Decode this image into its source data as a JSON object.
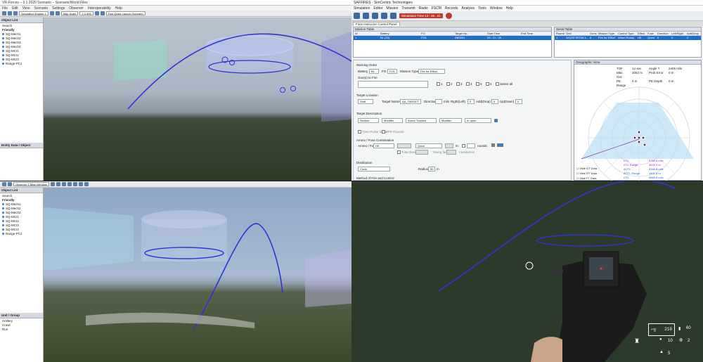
{
  "q1": {
    "title": "VR-Forces – 3.1 2020 Scenario – Scenario/World Files",
    "menu": [
      "File",
      "Edit",
      "View",
      "Scenario",
      "Settings",
      "Observer",
      "Interoperability",
      "Help"
    ],
    "toolbar_fields": [
      "Simulation Engine 1",
      "Map Scale",
      "1:2,500",
      "Run Quick Launch Scenario"
    ],
    "side_head": "Object List",
    "search_label": "Search",
    "tree_root": "Friendly",
    "tree_items": [
      "SQ-Mech1",
      "SQ-Mech2",
      "SQ-Mech3",
      "SQ-Mech4",
      "SQ-MCI1",
      "SQ-MCI2",
      "SQ-MCI3",
      "Range-PC1"
    ],
    "side_head2": "Entity Data / Object"
  },
  "q2": {
    "title": "SAFFIRES - SimCentric Technologies",
    "menu": [
      "Simulation",
      "Editor",
      "Mission",
      "Transmit",
      "Radio",
      "FSCM",
      "Records",
      "Analysis",
      "Tools",
      "Window",
      "Help"
    ],
    "sim_time": "Simulation Time 13 : 46 : 21",
    "tab_label": "Fires Instructor Control Panel",
    "mission_table": {
      "head": "Mission Table",
      "cols": [
        "Id",
        "Battery",
        "FO",
        "Target No.",
        "Start Time",
        "End Time"
      ],
      "rows": [
        [
          "1",
          "B1 (33)",
          "FO1",
          "AB0001",
          "09 : 21 : 05",
          ""
        ]
      ]
    },
    "serial_table": {
      "head": "Serial Table",
      "cols": [
        "Round",
        "Grid",
        "Guns",
        "Mission Type",
        "Control Type",
        "Effect",
        "Fuse",
        "Direction",
        "Left/Right",
        "Add/Drop"
      ],
      "rows": [
        [
          "1",
          "42QVE 90728 3...",
          "6",
          "Fire for Effect",
          "When Ready",
          "HE",
          "Quick",
          "0",
          "0",
          "0"
        ]
      ]
    },
    "warning_order": {
      "label": "Warning Order",
      "battery_label": "Battery",
      "battery": "B1",
      "fo_label": "FO",
      "fo": "FO1",
      "mission_type_label": "Mission Type",
      "mission_type": "Fire for Effect",
      "guns_label": "Gun(s) to Fire",
      "guns": [
        "1",
        "2",
        "3",
        "4",
        "5",
        "6"
      ],
      "select_all": "Select all"
    },
    "target_location": {
      "label": "Target Location",
      "grid": "Shift",
      "target_name_label": "Target Name",
      "target_name": "AA_TARGET",
      "direction_label": "Direction",
      "mils": "mils",
      "right_left_label": "Right(Left)",
      "right_left": "0",
      "add_drop_label": "Add(Drop)",
      "add_drop": "0",
      "up_down_label": "Up(Down)",
      "up_down": "0"
    },
    "target_description": {
      "label": "Target Description",
      "type": "Section",
      "modifier1": "Modifier",
      "subject": "Armor Tracked",
      "modifier2": "Modifier",
      "state": "In open"
    },
    "options": [
      "Time-Probe Serial",
      "VPE Rounds"
    ],
    "ammo": {
      "label": "Ammo / Fuse Combination",
      "ammo_label": "Ammo / Fuse",
      "ammo": "HE",
      "fuse": "Quick",
      "m": "m",
      "rounds": "rounds",
      "total_duration": "Total Duration",
      "timing_factor": "Timing factor",
      "roundsmin": "rounds/min"
    },
    "distribution": {
      "label": "Distribution",
      "pattern": "Circle",
      "radius_label": "Radius",
      "radius": "50",
      "unit": "m"
    },
    "method_label": "Method of Fire and Control",
    "geo": {
      "label": "Geographic View",
      "stats": [
        [
          "TOF",
          "14 sec",
          "Angle T",
          "2405 mils"
        ],
        [
          "Max Ord",
          "2062 m",
          "Prob Error",
          "0 m"
        ],
        [
          "PE Range",
          "0 m",
          "PE Depth",
          "0 m"
        ]
      ],
      "checks": [
        "Hide GT Data",
        "Hide OT Data",
        "Hide FT Data"
      ],
      "readouts": [
        [
          "GTL",
          "5769.8 mils"
        ],
        [
          "GTL Range",
          "4599.3 m"
        ],
        [
          "AOTL",
          "5348.8 mils"
        ],
        [
          "AOTL Range",
          "1401.8 m"
        ],
        [
          "OTL",
          "5869.8 mils"
        ]
      ]
    }
  },
  "q3": {
    "toolbar_fields": [
      "Observer  1  Main Window"
    ],
    "side_head": "Object List",
    "search_label": "Search",
    "tree_root": "Friendly",
    "tree_items": [
      "SQ-Mech1",
      "SQ-Mech2",
      "SQ-Mech3",
      "SQ-MCI1",
      "SQ-MCI2",
      "SQ-MCI3",
      "SQ-MCI4",
      "Range-PC1"
    ],
    "bottom_head": "Unit / Group",
    "groups": [
      "Artillery",
      "Crawl",
      "Run"
    ]
  },
  "q4": {
    "ammo_count": "210",
    "mag_count": "60",
    "grenades": "10",
    "smoke": "2",
    "special": "5"
  },
  "colors": {
    "trajectory": "#2f34d8",
    "selection": "#1f6fd1",
    "panel_bg": "#f0f0f0"
  }
}
